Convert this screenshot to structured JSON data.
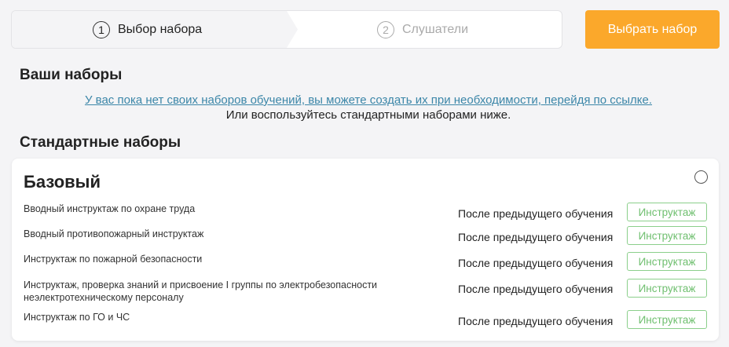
{
  "stepper": {
    "steps": [
      {
        "number": "1",
        "label": "Выбор набора"
      },
      {
        "number": "2",
        "label": "Слушатели"
      }
    ]
  },
  "action": {
    "select_label": "Выбрать набор"
  },
  "your_sets": {
    "title": "Ваши наборы",
    "empty_link": "У вас пока нет своих наборов обучений, вы можете создать их при необходимости, перейдя по ссылке.",
    "empty_hint": "Или воспользуйтесь стандартными наборами ниже."
  },
  "standard_sets": {
    "title": "Стандартные наборы",
    "card": {
      "title": "Базовый",
      "rows": [
        {
          "name": "Вводный инструктаж по охране труда",
          "when": "После предыдущего обучения",
          "tag": "Инструктаж"
        },
        {
          "name": "Вводный противопожарный инструктаж",
          "when": "После предыдущего обучения",
          "tag": "Инструктаж"
        },
        {
          "name": "Инструктаж по пожарной безопасности",
          "when": "После предыдущего обучения",
          "tag": "Инструктаж"
        },
        {
          "name": "Инструктаж, проверка знаний и присвоение I группы по электробезопасности неэлектротехническому персоналу",
          "when": "После предыдущего обучения",
          "tag": "Инструктаж"
        },
        {
          "name": "Инструктаж по ГО и ЧС",
          "when": "После предыдущего обучения",
          "tag": "Инструктаж"
        }
      ]
    }
  },
  "colors": {
    "accent": "#fba82b",
    "link": "#3b86a8",
    "tag": "#6fbf6f"
  }
}
